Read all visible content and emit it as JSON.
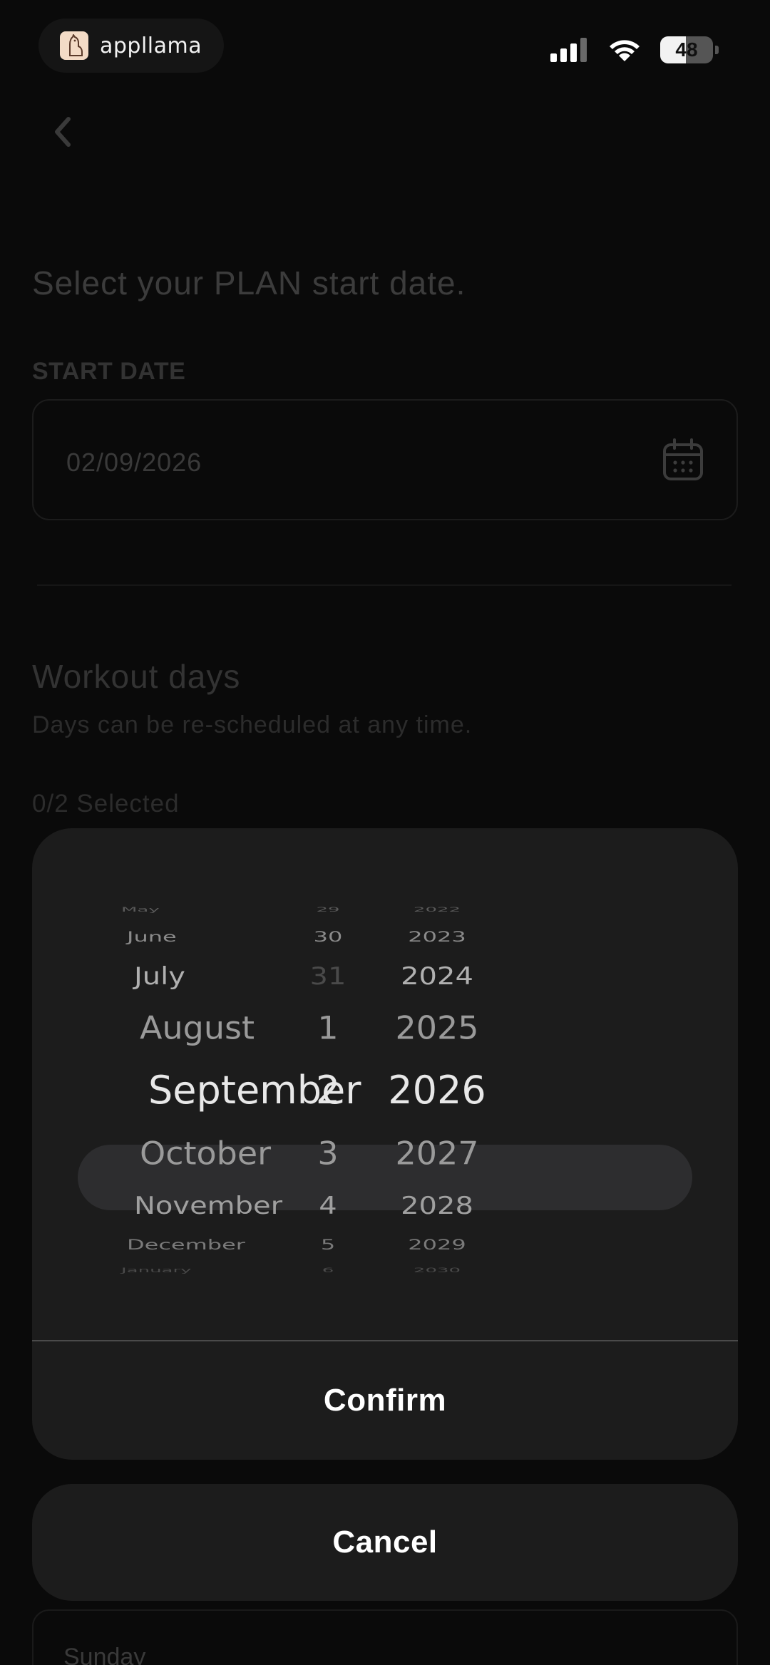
{
  "status_bar": {
    "brand": "appllama",
    "battery_level": "48",
    "battery_fraction": 0.48,
    "icons": [
      "cellular-signal-icon",
      "wifi-icon",
      "battery-icon"
    ]
  },
  "page": {
    "back_icon": "chevron-left-icon",
    "heading": "Select your PLAN start date.",
    "start_date_label": "START DATE",
    "start_date_value": "02/09/2026",
    "calendar_icon": "calendar-icon",
    "workout_title": "Workout days",
    "workout_subtitle": "Days can be re-scheduled at any time.",
    "selected_count": "0/2 Selected",
    "first_day": "Sunday"
  },
  "picker": {
    "months": [
      "May",
      "June",
      "July",
      "August",
      "September",
      "October",
      "November",
      "December",
      "January"
    ],
    "days": [
      "29",
      "30",
      "31",
      "1",
      "2",
      "3",
      "4",
      "5",
      "6"
    ],
    "years": [
      "2022",
      "2023",
      "2024",
      "2025",
      "2026",
      "2027",
      "2028",
      "2029",
      "2030"
    ],
    "selected": {
      "month": "September",
      "day": "2",
      "year": "2026"
    },
    "confirm_label": "Confirm",
    "cancel_label": "Cancel"
  }
}
